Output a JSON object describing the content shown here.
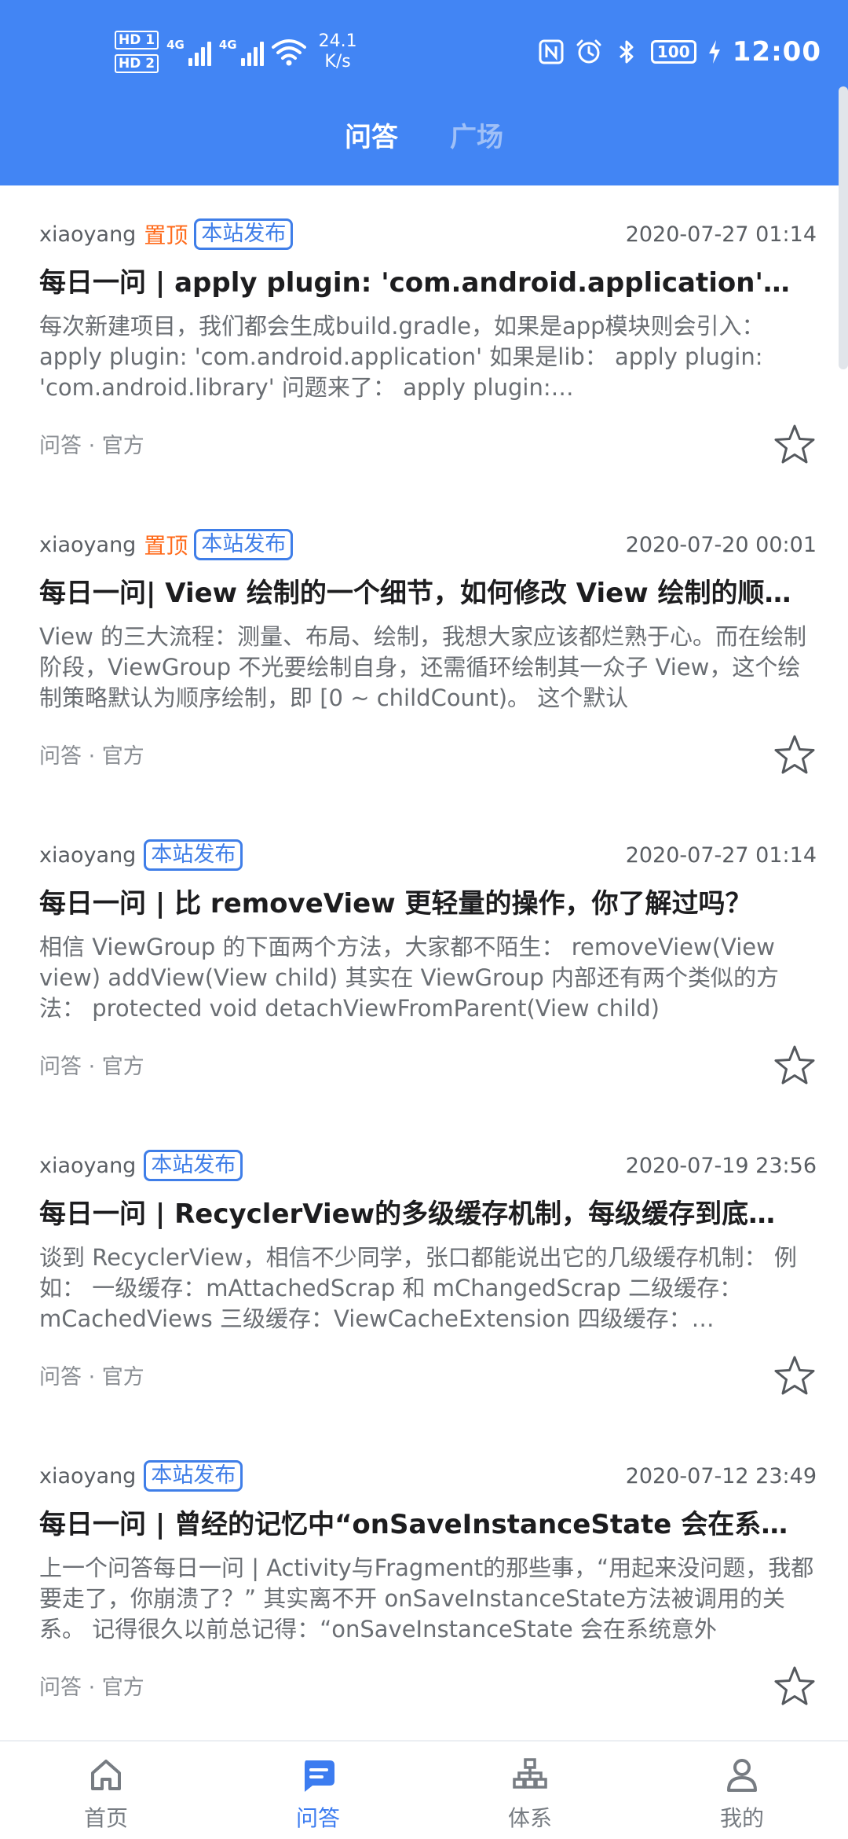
{
  "status_bar": {
    "hd1": "HD 1",
    "hd2": "HD 2",
    "network1": "4G",
    "network2": "4G",
    "speed_value": "24.1",
    "speed_unit": "K/s",
    "battery": "100",
    "time": "12:00"
  },
  "top_tabs": [
    {
      "label": "问答",
      "active": true
    },
    {
      "label": "广场",
      "active": false
    }
  ],
  "articles": [
    {
      "author": "xiaoyang",
      "top_label": "置顶",
      "source_label": "本站发布",
      "date": "2020-07-27 01:14",
      "title": "每日一问 | apply plugin: 'com.android.application' 背后发生了什么？",
      "desc": "每次新建项目，我们都会生成build.gradle，如果是app模块则会引入： apply plugin: 'com.android.application' 如果是lib： apply plugin: 'com.android.library' 问题来了： apply plugin: 'com.android.application' 背后",
      "chapter": "问答 · 官方"
    },
    {
      "author": "xiaoyang",
      "top_label": "置顶",
      "source_label": "本站发布",
      "date": "2020-07-20 00:01",
      "title": "每日一问| View 绘制的一个细节，如何修改 View 绘制的顺序？",
      "desc": "View 的三大流程：测量、布局、绘制，我想大家应该都烂熟于心。而在绘制阶段，ViewGroup 不光要绘制自身，还需循环绘制其一众子 View，这个绘制策略默认为顺序绘制，即 [0 ~ childCount)。 这个默认",
      "chapter": "问答 · 官方"
    },
    {
      "author": "xiaoyang",
      "top_label": "",
      "source_label": "本站发布",
      "date": "2020-07-27 01:14",
      "title": "每日一问 | 比 removeView 更轻量的操作，你了解过吗？",
      "desc": "相信 ViewGroup 的下面两个方法，大家都不陌生： removeView(View view) addView(View child) 其实在 ViewGroup 内部还有两个类似的方法： protected void detachViewFromParent(View child)",
      "chapter": "问答 · 官方"
    },
    {
      "author": "xiaoyang",
      "top_label": "",
      "source_label": "本站发布",
      "date": "2020-07-19 23:56",
      "title": "每日一问 | RecyclerView的多级缓存机制，每级缓存到底起到什么样的作用？",
      "desc": "谈到 RecyclerView，相信不少同学，张口都能说出它的几级缓存机制： 例如： 一级缓存：mAttachedScrap 和 mChangedScrap 二级缓存：mCachedViews 三级缓存：ViewCacheExtension 四级缓存：RecycledViewPool",
      "chapter": "问答 · 官方"
    },
    {
      "author": "xiaoyang",
      "top_label": "",
      "source_label": "本站发布",
      "date": "2020-07-12 23:49",
      "title": "每日一问 | 曾经的记忆中“onSaveInstanceState 会在系统意外销毁时调用”",
      "desc": "上一个问答每日一问 | Activity与Fragment的那些事，“用起来没问题，我都要走了，你崩溃了？” 其实离不开 onSaveInstanceState方法被调用的关系。 记得很久以前总记得：“onSaveInstanceState 会在系统意外",
      "chapter": "问答 · 官方"
    }
  ],
  "bottom_nav": [
    {
      "label": "首页",
      "icon": "home-icon",
      "active": false
    },
    {
      "label": "问答",
      "icon": "qa-icon",
      "active": true
    },
    {
      "label": "体系",
      "icon": "system-icon",
      "active": false
    },
    {
      "label": "我的",
      "icon": "profile-icon",
      "active": false
    }
  ],
  "colors": {
    "primary": "#4285f4",
    "tag_top": "#ff6a1a",
    "tag_site": "#3f7ee8",
    "nav_active": "#3c7cf0",
    "nav_inactive": "#777c82"
  }
}
